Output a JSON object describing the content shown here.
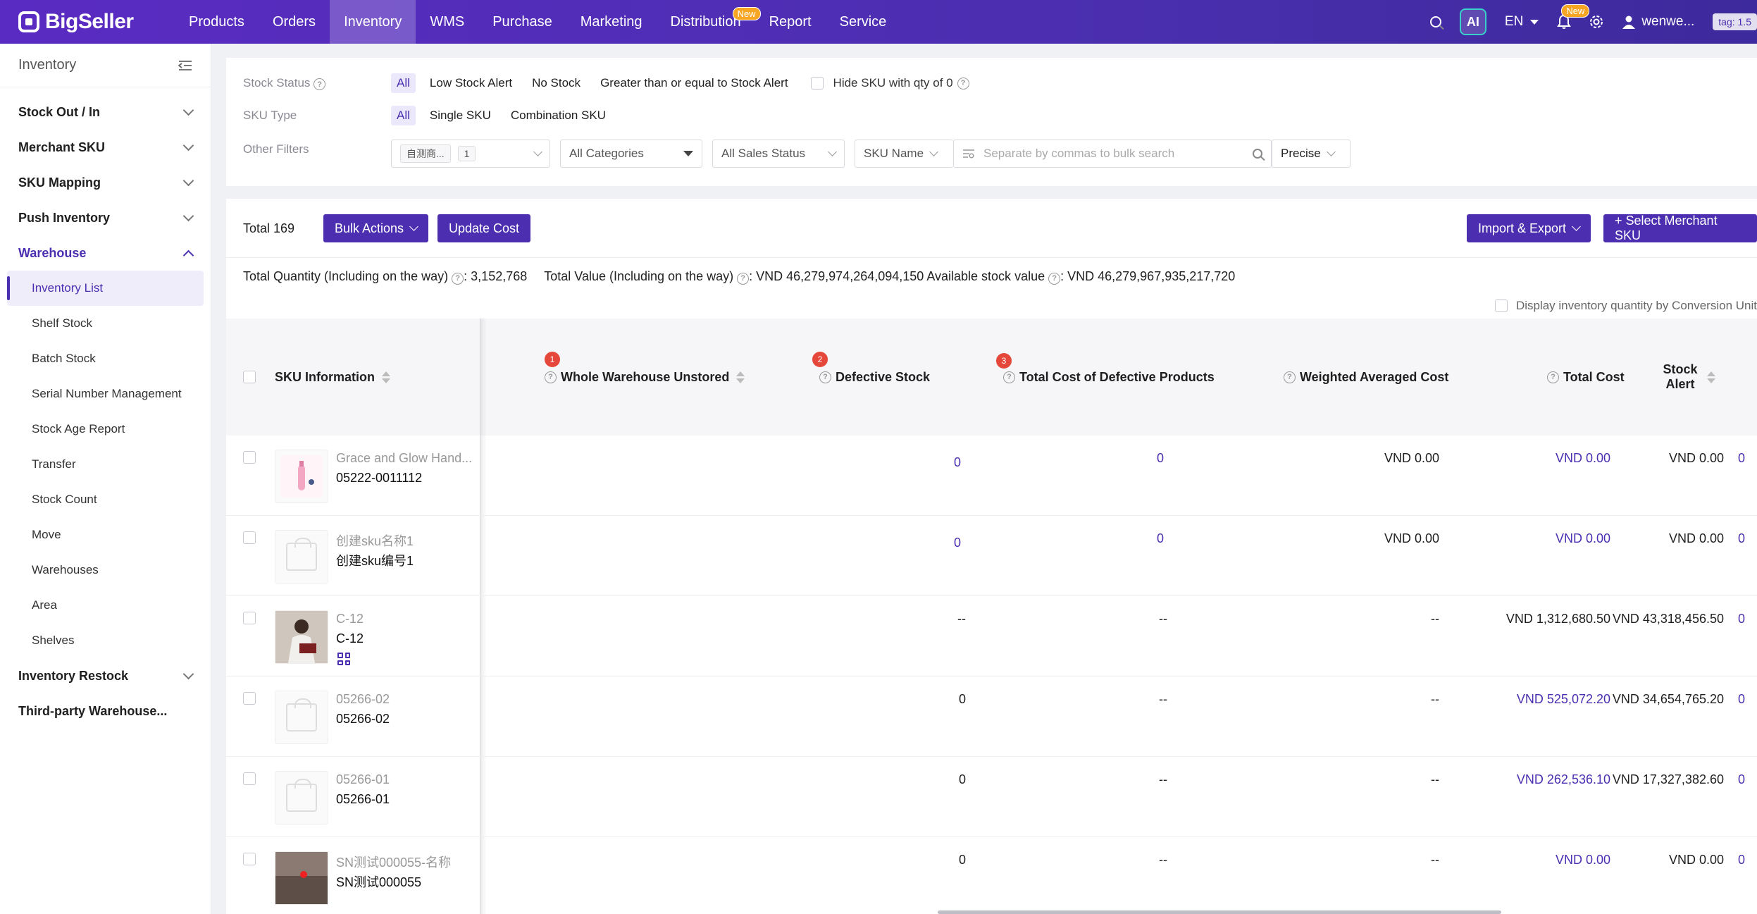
{
  "brand": {
    "name": "BigSeller",
    "accent": "#4b2fb0",
    "new_badge_color": "#f6a623"
  },
  "nav": {
    "items": [
      "Products",
      "Orders",
      "Inventory",
      "WMS",
      "Purchase",
      "Marketing",
      "Distribution",
      "Report",
      "Service"
    ],
    "active": "Inventory",
    "distribution_badge": "New"
  },
  "topright": {
    "ai": "AI",
    "lang": "EN",
    "bell_badge": "New",
    "user": "wenwe...",
    "tag": "tag: 1.5"
  },
  "sidebar": {
    "title": "Inventory",
    "groups": {
      "stock_out_in": "Stock Out / In",
      "merchant_sku": "Merchant SKU",
      "sku_mapping": "SKU Mapping",
      "push_inventory": "Push Inventory",
      "warehouse": "Warehouse",
      "inventory_restock": "Inventory Restock",
      "third_party": "Third-party Warehouse..."
    },
    "warehouse_items": [
      "Inventory List",
      "Shelf Stock",
      "Batch Stock",
      "Serial Number Management",
      "Stock Age Report",
      "Transfer",
      "Stock Count",
      "Move",
      "Warehouses",
      "Area",
      "Shelves"
    ],
    "active_item": "Inventory List"
  },
  "filters": {
    "stock_status_label": "Stock Status",
    "stock_status_options": [
      "All",
      "Low Stock Alert",
      "No Stock",
      "Greater than or equal to Stock Alert"
    ],
    "hide_zero_label": "Hide SKU with qty of 0",
    "sku_type_label": "SKU Type",
    "sku_type_options": [
      "All",
      "Single SKU",
      "Combination SKU"
    ],
    "other_filters_label": "Other Filters",
    "warehouse_tag": "自测商...",
    "warehouse_count": "1",
    "category": "All Categories",
    "sales_status": "All Sales Status",
    "search_field": "SKU Name",
    "search_placeholder": "Separate by commas to bulk search",
    "match_mode": "Precise"
  },
  "toolbar": {
    "total": "Total 169",
    "bulk_actions": "Bulk Actions",
    "update_cost": "Update Cost",
    "import_export": "Import & Export",
    "select_merchant_sku": "+ Select Merchant SKU"
  },
  "summary": {
    "total_quantity_label": "Total Quantity (Including on the way)",
    "total_quantity": ": 3,152,768",
    "total_value_label": "Total Value (Including on the way)",
    "total_value": ": VND 46,279,974,264,094,150",
    "available_label": "Available stock value",
    "available_value": ": VND 46,279,967,935,217,720",
    "conversion_label": "Display inventory quantity by Conversion Unit"
  },
  "table": {
    "headers": {
      "sku_info": "SKU Information",
      "unstored": "Whole Warehouse Unstored",
      "defective": "Defective Stock",
      "defective_cost": "Total Cost of Defective Products",
      "weighted_cost": "Weighted Averaged Cost",
      "total_cost": "Total Cost",
      "stock_alert": "Stock Alert"
    },
    "header_badges": [
      "1",
      "2",
      "3"
    ],
    "rows": [
      {
        "name": "Grace and Glow Hand...",
        "code": "05222-0011112",
        "unstored": "0",
        "defective": "0",
        "defective_cost": "VND 0.00",
        "weighted": "VND 0.00",
        "total": "VND 0.00",
        "alert": "0"
      },
      {
        "name": "创建sku名称1",
        "code": "创建sku编号1",
        "unstored": "0",
        "defective": "0",
        "defective_cost": "VND 0.00",
        "weighted": "VND 0.00",
        "total": "VND 0.00",
        "alert": "0"
      },
      {
        "name": "C-12",
        "code": "C-12",
        "unstored": "--",
        "defective": "--",
        "defective_cost": "--",
        "weighted": "VND 1,312,680.50",
        "total": "VND 43,318,456.50",
        "alert": "0"
      },
      {
        "name": "05266-02",
        "code": "05266-02",
        "unstored": "0",
        "defective": "--",
        "defective_cost": "--",
        "weighted": "VND 525,072.20",
        "total": "VND 34,654,765.20",
        "alert": "0"
      },
      {
        "name": "05266-01",
        "code": "05266-01",
        "unstored": "0",
        "defective": "--",
        "defective_cost": "--",
        "weighted": "VND 262,536.10",
        "total": "VND 17,327,382.60",
        "alert": "0"
      },
      {
        "name": "SN测试000055-名称",
        "code": "SN测试000055",
        "unstored": "0",
        "defective": "--",
        "defective_cost": "--",
        "weighted": "VND 0.00",
        "total": "VND 0.00",
        "alert": "0"
      }
    ]
  }
}
